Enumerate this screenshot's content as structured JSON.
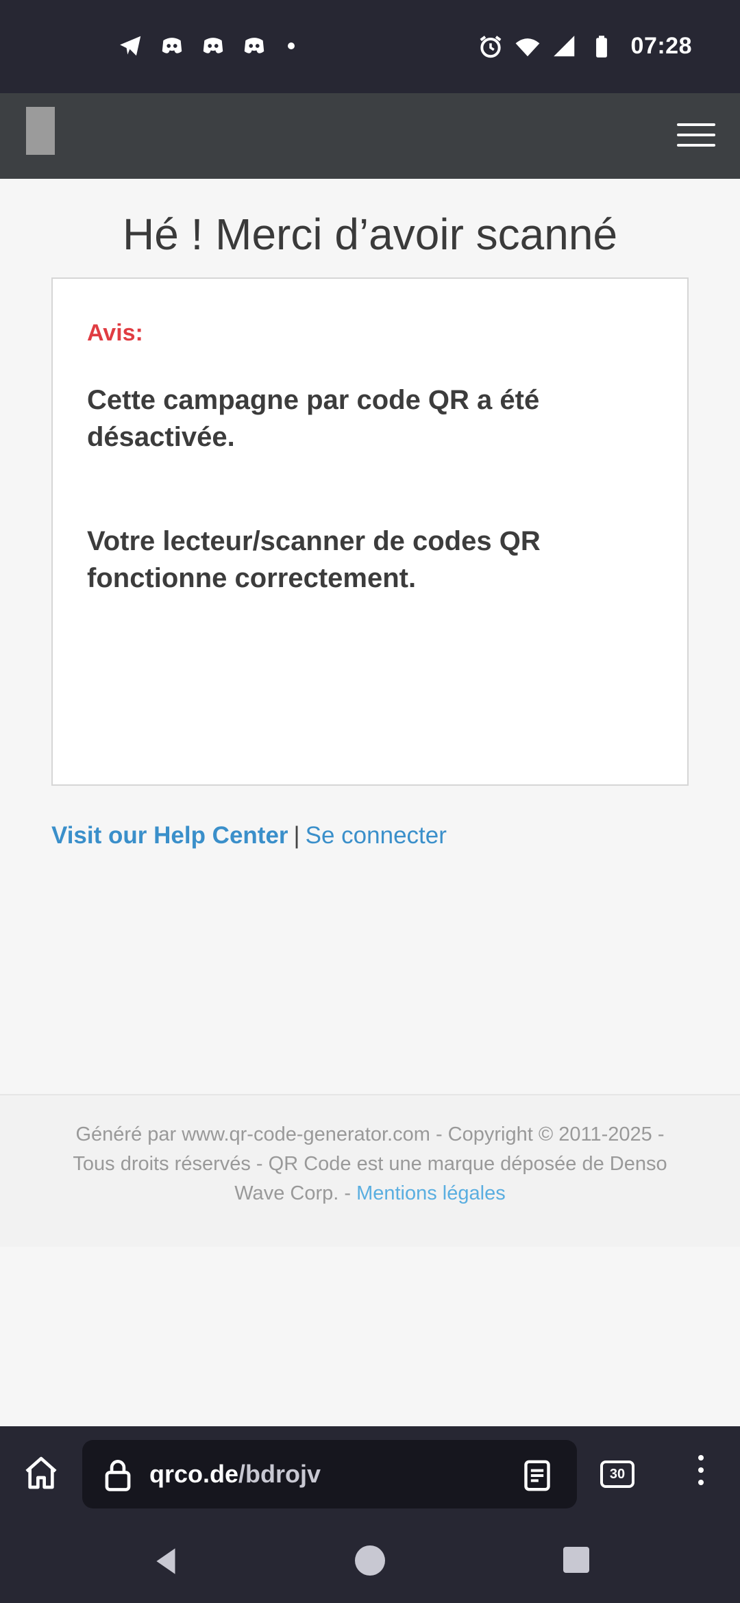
{
  "status_bar": {
    "time": "07:28",
    "notification_icons": [
      "telegram-icon",
      "discord-icon",
      "discord-icon",
      "discord-icon"
    ],
    "system_icons": [
      "alarm-icon",
      "wifi-icon",
      "signal-icon",
      "battery-icon"
    ]
  },
  "page": {
    "title": "Hé ! Merci d’avoir scanné",
    "notice_label": "Avis:",
    "message_1": "Cette campagne par code QR a été désactivée.",
    "message_2": "Votre lecteur/scanner de codes QR fonctionne correctement."
  },
  "links": {
    "help_center": "Visit our Help Center",
    "separator": "|",
    "login": "Se connecter"
  },
  "footer": {
    "text": "Généré par www.qr-code-generator.com - Copyright © 2011-2025 - Tous droits réservés - QR Code est une marque déposée de Denso Wave Corp. -",
    "legal_link": "Mentions légales"
  },
  "browser": {
    "url_domain": "qrco.de",
    "url_path": "/bdrojv",
    "tab_count": "30"
  },
  "colors": {
    "status_bar_bg": "#272733",
    "header_bg": "#3d4043",
    "notice_red": "#e03c42",
    "link_blue": "#3a8fca"
  }
}
